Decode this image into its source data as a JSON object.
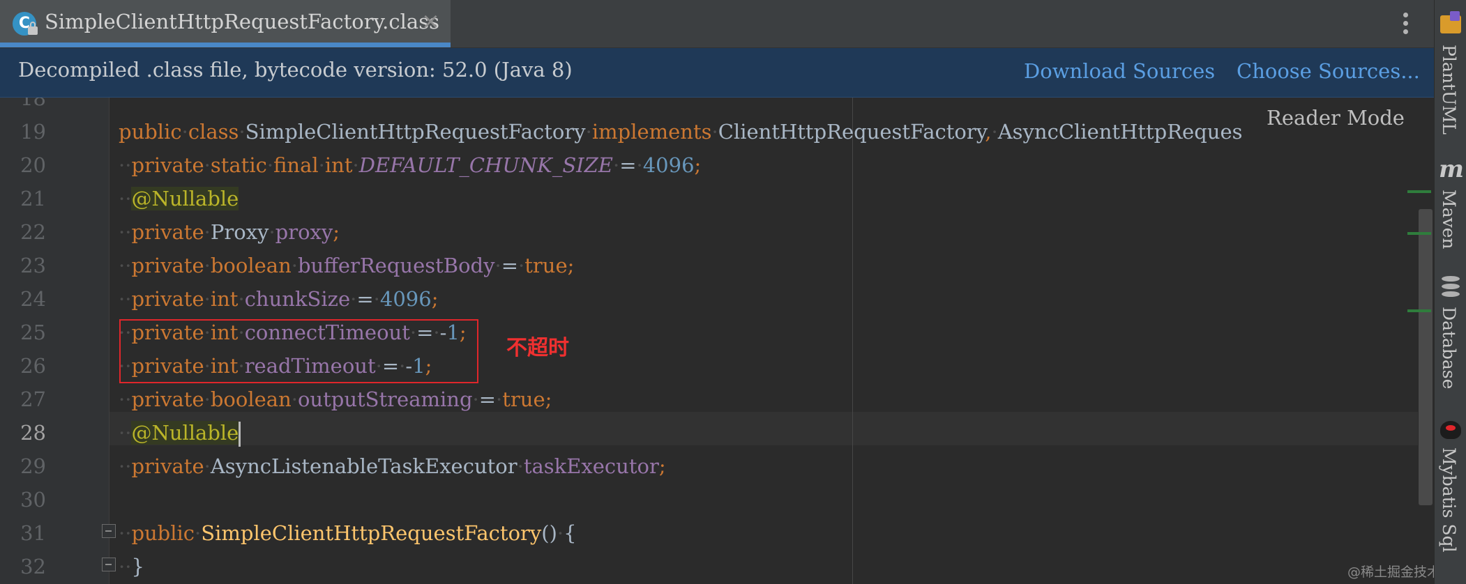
{
  "tab": {
    "icon_letter": "C",
    "title": "SimpleClientHttpRequestFactory.class",
    "close_glyph": "×"
  },
  "banner": {
    "message": "Decompiled .class file, bytecode version: 52.0 (Java 8)",
    "download_sources": "Download Sources",
    "choose_sources": "Choose Sources..."
  },
  "editor": {
    "reader_mode": "Reader Mode",
    "line_numbers": [
      "18",
      "19",
      "20",
      "21",
      "22",
      "23",
      "24",
      "25",
      "26",
      "27",
      "28",
      "29",
      "30",
      "31",
      "32"
    ],
    "current_line": "28",
    "lines": [
      [],
      [
        [
          "kw",
          "public"
        ],
        [
          "ws",
          "·"
        ],
        [
          "kw",
          "class"
        ],
        [
          "ws",
          "·"
        ],
        [
          "typ",
          "SimpleClientHttpRequestFactory"
        ],
        [
          "ws",
          "·"
        ],
        [
          "kw",
          "implements"
        ],
        [
          "ws",
          "·"
        ],
        [
          "typ",
          "ClientHttpRequestFactory"
        ],
        [
          "kw",
          ","
        ],
        [
          "ws",
          "·"
        ],
        [
          "typ",
          "AsyncClientHttpReques"
        ]
      ],
      [
        [
          "ws",
          "··"
        ],
        [
          "kw",
          "private"
        ],
        [
          "ws",
          "·"
        ],
        [
          "kw",
          "static"
        ],
        [
          "ws",
          "·"
        ],
        [
          "kw",
          "final"
        ],
        [
          "ws",
          "·"
        ],
        [
          "kw",
          "int"
        ],
        [
          "ws",
          "·"
        ],
        [
          "cst",
          "DEFAULT_CHUNK_SIZE"
        ],
        [
          "ws",
          "·"
        ],
        [
          "op",
          "="
        ],
        [
          "ws",
          "·"
        ],
        [
          "num",
          "4096"
        ],
        [
          "kw",
          ";"
        ]
      ],
      [
        [
          "ws",
          "··"
        ],
        [
          "ann",
          "@Nullable"
        ]
      ],
      [
        [
          "ws",
          "··"
        ],
        [
          "kw",
          "private"
        ],
        [
          "ws",
          "·"
        ],
        [
          "typ",
          "Proxy"
        ],
        [
          "ws",
          "·"
        ],
        [
          "fld",
          "proxy"
        ],
        [
          "kw",
          ";"
        ]
      ],
      [
        [
          "ws",
          "··"
        ],
        [
          "kw",
          "private"
        ],
        [
          "ws",
          "·"
        ],
        [
          "kw",
          "boolean"
        ],
        [
          "ws",
          "·"
        ],
        [
          "fld",
          "bufferRequestBody"
        ],
        [
          "ws",
          "·"
        ],
        [
          "op",
          "="
        ],
        [
          "ws",
          "·"
        ],
        [
          "kw",
          "true"
        ],
        [
          "kw",
          ";"
        ]
      ],
      [
        [
          "ws",
          "··"
        ],
        [
          "kw",
          "private"
        ],
        [
          "ws",
          "·"
        ],
        [
          "kw",
          "int"
        ],
        [
          "ws",
          "·"
        ],
        [
          "fld",
          "chunkSize"
        ],
        [
          "ws",
          "·"
        ],
        [
          "op",
          "="
        ],
        [
          "ws",
          "·"
        ],
        [
          "num",
          "4096"
        ],
        [
          "kw",
          ";"
        ]
      ],
      [
        [
          "ws",
          "··"
        ],
        [
          "kw",
          "private"
        ],
        [
          "ws",
          "·"
        ],
        [
          "kw",
          "int"
        ],
        [
          "ws",
          "·"
        ],
        [
          "fld",
          "connectTimeout"
        ],
        [
          "ws",
          "·"
        ],
        [
          "op",
          "="
        ],
        [
          "ws",
          "·"
        ],
        [
          "op",
          "-"
        ],
        [
          "num",
          "1"
        ],
        [
          "kw",
          ";"
        ]
      ],
      [
        [
          "ws",
          "··"
        ],
        [
          "kw",
          "private"
        ],
        [
          "ws",
          "·"
        ],
        [
          "kw",
          "int"
        ],
        [
          "ws",
          "·"
        ],
        [
          "fld",
          "readTimeout"
        ],
        [
          "ws",
          "·"
        ],
        [
          "op",
          "="
        ],
        [
          "ws",
          "·"
        ],
        [
          "op",
          "-"
        ],
        [
          "num",
          "1"
        ],
        [
          "kw",
          ";"
        ]
      ],
      [
        [
          "ws",
          "··"
        ],
        [
          "kw",
          "private"
        ],
        [
          "ws",
          "·"
        ],
        [
          "kw",
          "boolean"
        ],
        [
          "ws",
          "·"
        ],
        [
          "fld",
          "outputStreaming"
        ],
        [
          "ws",
          "·"
        ],
        [
          "op",
          "="
        ],
        [
          "ws",
          "·"
        ],
        [
          "kw",
          "true"
        ],
        [
          "kw",
          ";"
        ]
      ],
      [
        [
          "ws",
          "··"
        ],
        [
          "ann",
          "@Nullable"
        ]
      ],
      [
        [
          "ws",
          "··"
        ],
        [
          "kw",
          "private"
        ],
        [
          "ws",
          "·"
        ],
        [
          "typ",
          "AsyncListenableTaskExecutor"
        ],
        [
          "ws",
          "·"
        ],
        [
          "fld",
          "taskExecutor"
        ],
        [
          "kw",
          ";"
        ]
      ],
      [],
      [
        [
          "ws",
          "··"
        ],
        [
          "kw",
          "public"
        ],
        [
          "ws",
          "·"
        ],
        [
          "fn",
          "SimpleClientHttpRequestFactory"
        ],
        [
          "op",
          "()"
        ],
        [
          "ws",
          "·"
        ],
        [
          "op",
          "{"
        ]
      ],
      [
        [
          "ws",
          "··"
        ],
        [
          "op",
          "}"
        ]
      ]
    ],
    "annotation_label": "不超时",
    "watermark": "@稀土掘金技术社区"
  },
  "toolstrip": {
    "items": [
      "PlantUML",
      "Maven",
      "Database",
      "Mybatis Sql"
    ]
  },
  "colors": {
    "keyword": "#cc7832",
    "field": "#9876aa",
    "number": "#6897bb",
    "annotation": "#bbb529",
    "method": "#ffc66d",
    "highlight_box": "#e0262b",
    "link": "#5b9fe3"
  }
}
